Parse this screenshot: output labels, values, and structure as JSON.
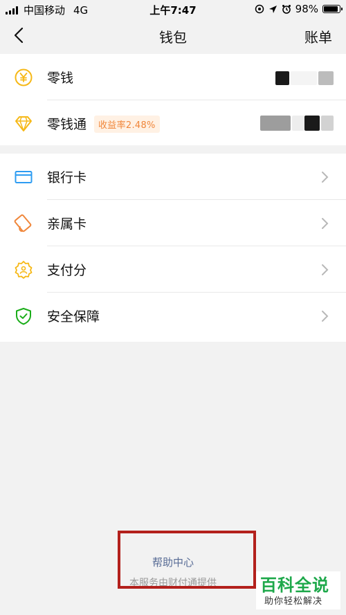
{
  "status_bar": {
    "carrier": "中国移动",
    "network": "4G",
    "time": "上午7:47",
    "battery": "98%"
  },
  "nav": {
    "title": "钱包",
    "bill": "账单"
  },
  "section1": {
    "items": [
      {
        "label": "零钱"
      },
      {
        "label": "零钱通",
        "badge": "收益率2.48%"
      }
    ]
  },
  "section2": {
    "items": [
      {
        "label": "银行卡"
      },
      {
        "label": "亲属卡"
      },
      {
        "label": "支付分"
      },
      {
        "label": "安全保障"
      }
    ]
  },
  "footer": {
    "help": "帮助中心",
    "note": "本服务由财付通提供"
  },
  "watermark": {
    "main": "百科全说",
    "sub": "助你轻松解决"
  },
  "colors": {
    "yellow": "#f6b816",
    "blue": "#2d9cf2",
    "orange": "#f0863a",
    "green": "#1aad19",
    "link": "#576b95"
  }
}
